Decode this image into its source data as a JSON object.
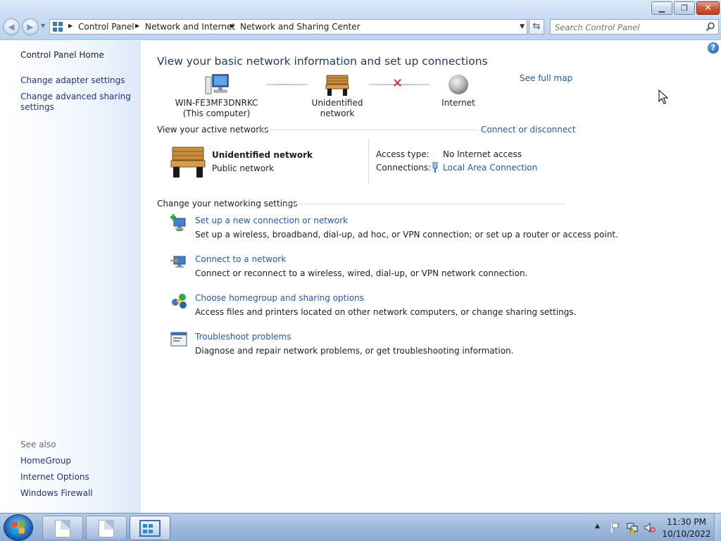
{
  "window": {
    "minimize_glyph": "▁",
    "maximize_glyph": "❐",
    "close_glyph": "✕"
  },
  "address": {
    "crumbs": [
      "Control Panel",
      "Network and Internet",
      "Network and Sharing Center"
    ],
    "search_placeholder": "Search Control Panel"
  },
  "sidebar": {
    "home": "Control Panel Home",
    "links": [
      "Change adapter settings",
      "Change advanced sharing settings"
    ],
    "see_also_label": "See also",
    "see_also": [
      "HomeGroup",
      "Internet Options",
      "Windows Firewall"
    ]
  },
  "main": {
    "title": "View your basic network information and set up connections",
    "see_full_map": "See full map",
    "map": {
      "computer_name": "WIN-FE3MF3DNRKC",
      "computer_sub": "(This computer)",
      "network": "Unidentified network",
      "internet": "Internet"
    },
    "active_networks_header": "View your active networks",
    "connect_or_disconnect": "Connect or disconnect",
    "active_network": {
      "name": "Unidentified network",
      "type": "Public network",
      "access_type_label": "Access type:",
      "access_type_value": "No Internet access",
      "connections_label": "Connections:",
      "connections_value": "Local Area Connection"
    },
    "change_settings_header": "Change your networking settings",
    "tasks": [
      {
        "icon": "new-connection-icon",
        "link": "Set up a new connection or network",
        "desc": "Set up a wireless, broadband, dial-up, ad hoc, or VPN connection; or set up a router or access point."
      },
      {
        "icon": "connect-network-icon",
        "link": "Connect to a network",
        "desc": "Connect or reconnect to a wireless, wired, dial-up, or VPN network connection."
      },
      {
        "icon": "homegroup-icon",
        "link": "Choose homegroup and sharing options",
        "desc": "Access files and printers located on other network computers, or change sharing settings."
      },
      {
        "icon": "troubleshoot-icon",
        "link": "Troubleshoot problems",
        "desc": "Diagnose and repair network problems, or get troubleshooting information."
      }
    ]
  },
  "taskbar": {
    "time": "11:30 PM",
    "date": "10/10/2022"
  },
  "colors": {
    "link": "#1e5aa8",
    "sidebar_link": "#1e3287",
    "title": "#1e395b",
    "error_x": "#d11f1f"
  }
}
